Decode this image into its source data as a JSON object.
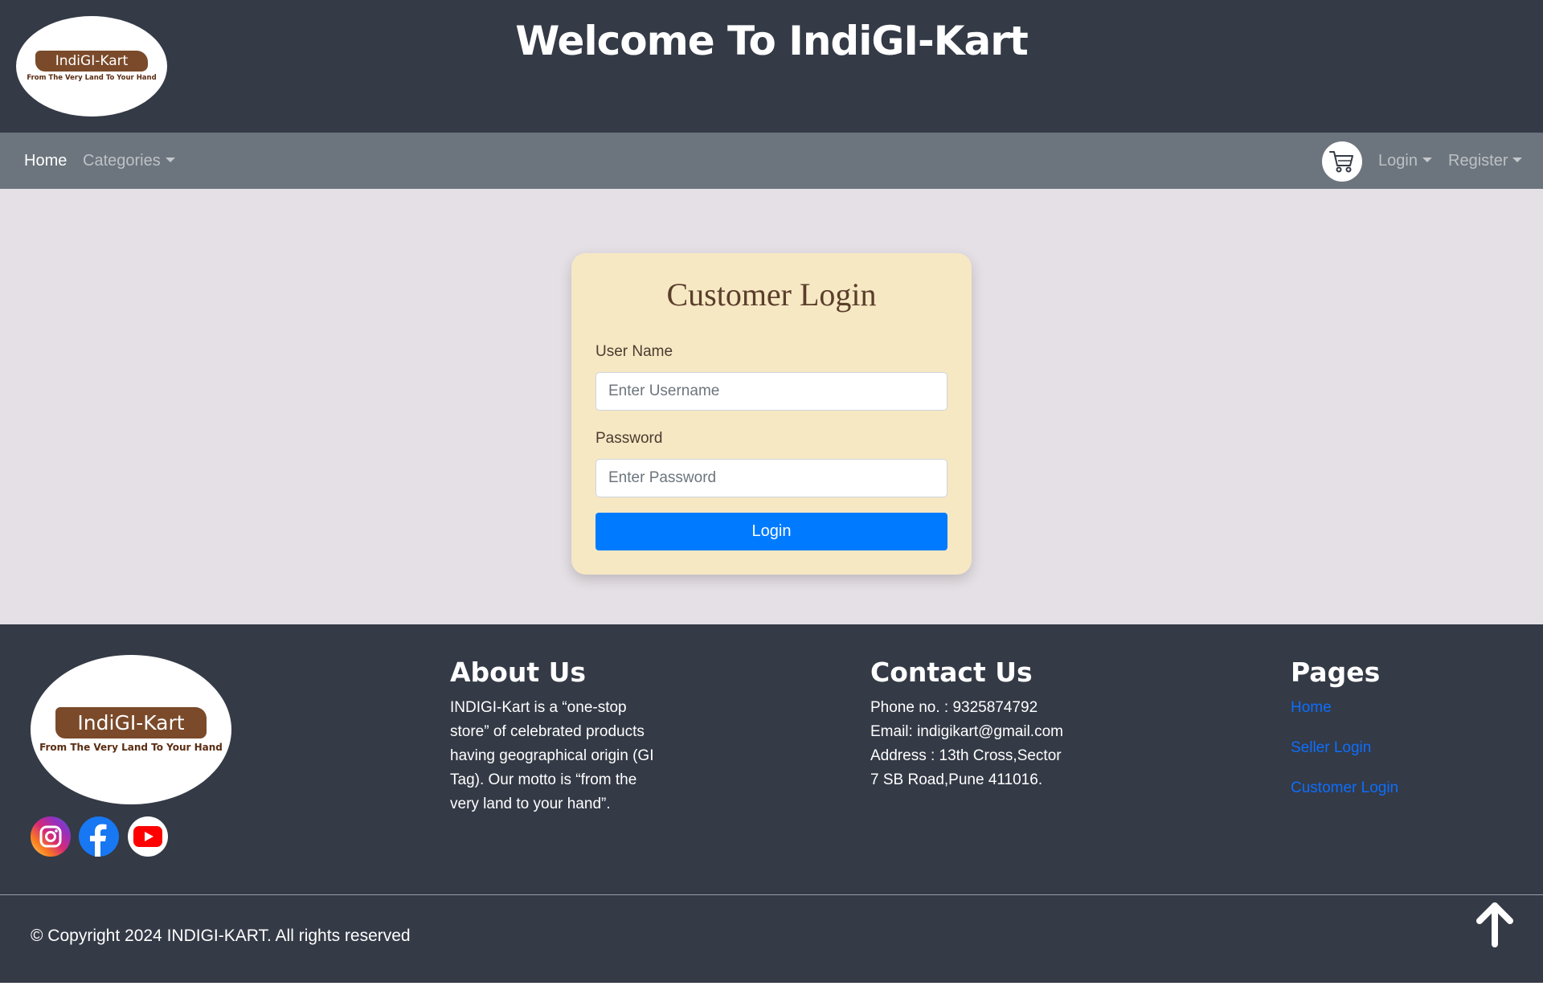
{
  "header": {
    "title": "Welcome To IndiGI-Kart",
    "logo_text": "IndiGI-Kart",
    "logo_tagline": "From The Very Land To Your Hand"
  },
  "nav": {
    "home": "Home",
    "categories": "Categories",
    "login": "Login",
    "register": "Register",
    "cart_icon": "cart-icon"
  },
  "login_form": {
    "title": "Customer Login",
    "username_label": "User Name",
    "username_placeholder": "Enter Username",
    "password_label": "Password",
    "password_placeholder": "Enter Password",
    "submit_label": "Login"
  },
  "footer": {
    "logo_text": "IndiGI-Kart",
    "logo_tagline": "From The Very Land To Your Hand",
    "about": {
      "heading": "About Us",
      "lines": [
        "INDIGI-Kart is a “one-stop",
        "store” of celebrated products",
        "having geographical origin (GI",
        "Tag). Our motto is “from the",
        "very land to your hand”."
      ]
    },
    "contact": {
      "heading": "Contact Us",
      "lines": [
        "Phone no. : 9325874792",
        "Email: indigikart@gmail.com",
        "Address : 13th Cross,Sector",
        "7 SB Road,Pune 411016."
      ]
    },
    "pages": {
      "heading": "Pages",
      "links": [
        "Home",
        "Seller Login",
        "Customer Login"
      ]
    },
    "copyright": "© Copyright 2024 INDIGI-KART. All rights reserved",
    "social_icons": [
      "instagram-icon",
      "facebook-icon",
      "youtube-icon"
    ]
  },
  "colors": {
    "header_bg": "#343a46",
    "navbar_bg": "#6c757d",
    "main_bg": "#e5e0e5",
    "card_bg": "#f7e8c4",
    "primary": "#007bff",
    "link": "#0d6efd"
  }
}
